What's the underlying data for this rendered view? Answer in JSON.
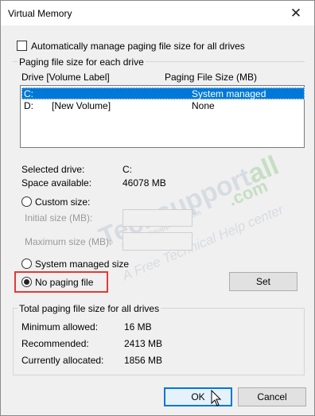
{
  "window": {
    "title": "Virtual Memory",
    "close_glyph": "✕"
  },
  "auto_manage": {
    "label": "Automatically manage paging file size for all drives",
    "checked": false
  },
  "paging_group": {
    "legend": "Paging file size for each drive",
    "col_drive": "Drive  [Volume Label]",
    "col_size": "Paging File Size (MB)",
    "rows": [
      {
        "drive": "C:",
        "label": "",
        "size": "System managed",
        "selected": true
      },
      {
        "drive": "D:",
        "label": "[New Volume]",
        "size": "None",
        "selected": false
      }
    ]
  },
  "selected_drive": {
    "label": "Selected drive:",
    "value": "C:"
  },
  "space_available": {
    "label": "Space available:",
    "value": "46078 MB"
  },
  "custom_size": {
    "label": "Custom size:",
    "selected": false
  },
  "initial_size": {
    "label": "Initial size (MB):",
    "value": ""
  },
  "maximum_size": {
    "label": "Maximum size (MB):",
    "value": ""
  },
  "system_managed": {
    "label": "System managed size",
    "selected": false
  },
  "no_paging": {
    "label": "No paging file",
    "selected": true
  },
  "set_button": "Set",
  "total_group": {
    "legend": "Total paging file size for all drives",
    "minimum_label": "Minimum allowed:",
    "minimum_value": "16 MB",
    "recommended_label": "Recommended:",
    "recommended_value": "2413 MB",
    "allocated_label": "Currently allocated:",
    "allocated_value": "1856 MB"
  },
  "ok_button": "OK",
  "cancel_button": "Cancel",
  "watermark": {
    "brand": "Techsupport",
    "brand_suffix": "all",
    "domain": ".com",
    "url": "www.Techsupportall.com",
    "tagline": "A Free Technical Help center"
  },
  "colors": {
    "selection": "#0078d7",
    "highlight_box": "#e53935"
  }
}
